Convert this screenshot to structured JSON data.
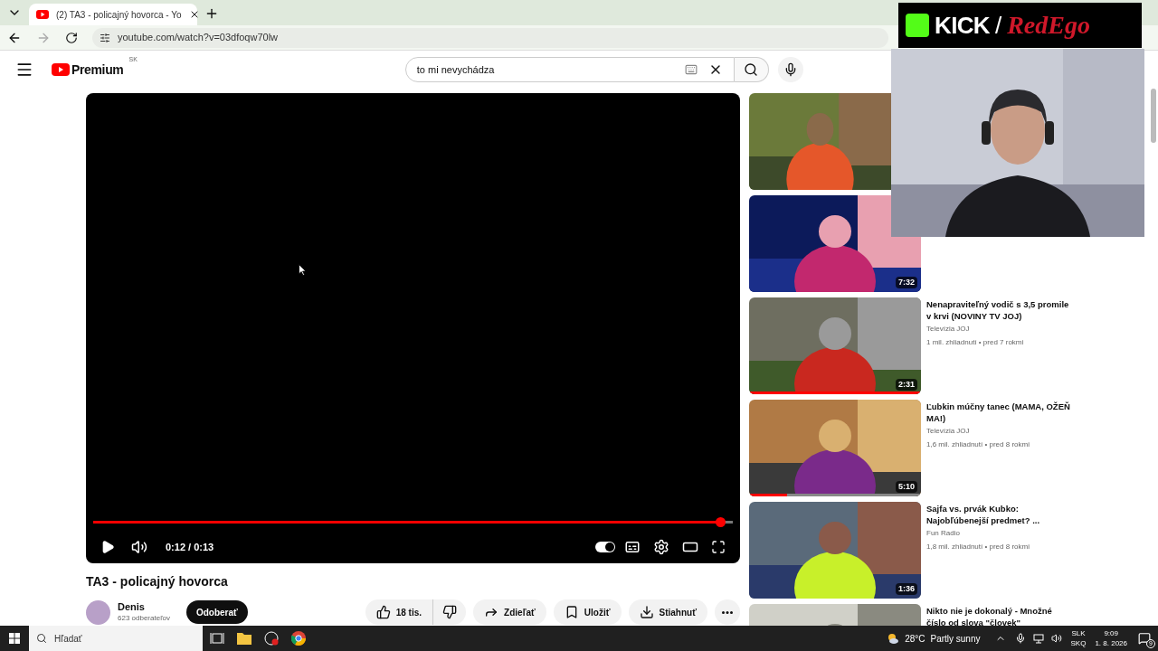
{
  "browser": {
    "tab_title": "(2) TA3 - policajný hovorca - Yo",
    "url": "youtube.com/watch?v=03dfoqw70lw"
  },
  "header": {
    "logo_text": "Premium",
    "region": "SK",
    "search": {
      "value": "to mi nevychádza"
    }
  },
  "player": {
    "progress": {
      "level": 0.982
    },
    "time": "0:12 / 0:13",
    "autoplay": {
      "on": true
    }
  },
  "video": {
    "title": "TA3 - policajný hovorca",
    "channel": "Denis",
    "subscribers": "623 odberateľov",
    "subscribe": "Odoberať",
    "likes": "18 tis.",
    "actions": [
      {
        "kind": "share",
        "label": "Zdieľať"
      },
      {
        "kind": "save",
        "label": "Uložiť"
      },
      {
        "kind": "download",
        "label": "Stiahnuť"
      }
    ]
  },
  "recommendations": [
    {
      "kind": "video"
    },
    {
      "kind": "video",
      "duration": "7:32"
    },
    {
      "kind": "video",
      "duration": "2:31",
      "title": "Nenapraviteľný vodič s 3,5 promile v krvi (NOVINY TV JOJ)",
      "channel": "Televízia JOJ",
      "meta": "1 mil. zhliadnutí • pred 7 rokmi",
      "watched": {
        "level": 1
      }
    },
    {
      "kind": "video",
      "duration": "5:10",
      "title": "Ľubkin múčny tanec (MAMA, OŽEŇ MA!)",
      "channel": "Televízia JOJ",
      "meta": "1,6 mil. zhliadnutí • pred 8 rokmi",
      "watched": {
        "level": 0.22
      }
    },
    {
      "kind": "video",
      "duration": "1:36",
      "title": "Sajfa vs. prvák Kubko: Najobľúbenejší predmet? ...",
      "channel": "Fun Radio",
      "meta": "1,8 mil. zhliadnutí • pred 8 rokmi"
    },
    {
      "kind": "video",
      "title": "Nikto nie je dokonalý - Množné číslo od slova \"človek\""
    }
  ],
  "overlay": {
    "brand": "KICK",
    "separator": "/",
    "channel": "RedEgo"
  },
  "taskbar": {
    "search_placeholder": "Hľadať",
    "temperature": "28°C",
    "weather": "Partly sunny",
    "language": [
      "SLK",
      "SKQ"
    ],
    "time": "9:09",
    "date": "1. 8. 2026",
    "notifications": "9"
  }
}
